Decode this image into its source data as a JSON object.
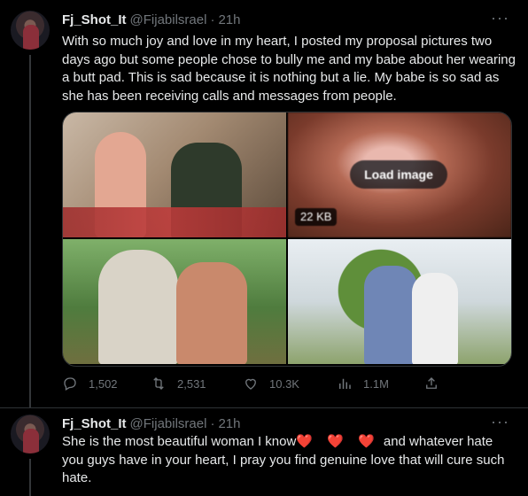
{
  "tweets": [
    {
      "display_name": "Fj_Shot_It",
      "handle": "@Fijabilsrael",
      "separator": "·",
      "time": "21h",
      "more": "···",
      "text": "With so much joy and love in my heart, I posted my proposal pictures two days ago but some people chose to bully me and my babe about her wearing a butt pad. This is sad because it is nothing but a lie. My babe is so sad as she has been receiving calls and messages from people.",
      "media": {
        "load_image_label": "Load image",
        "size_badge": "22 KB"
      },
      "actions": {
        "replies": "1,502",
        "retweets": "2,531",
        "likes": "10.3K",
        "views": "1.1M"
      }
    },
    {
      "display_name": "Fj_Shot_It",
      "handle": "@Fijabilsrael",
      "separator": "·",
      "time": "21h",
      "more": "···",
      "text_before": "She is the most beautiful woman I know",
      "hearts": "❤️ ❤️ ❤️",
      "text_after": " and whatever hate you guys have in your heart, I pray you find genuine love that will cure such hate."
    }
  ],
  "icons": {
    "reply": "reply-icon",
    "retweet": "retweet-icon",
    "like": "heart-icon",
    "views": "views-icon",
    "share": "share-icon",
    "more": "more-icon"
  },
  "colors": {
    "background": "#000000",
    "text": "#e7e9ea",
    "muted": "#71767b",
    "heart": "#d7263d"
  }
}
